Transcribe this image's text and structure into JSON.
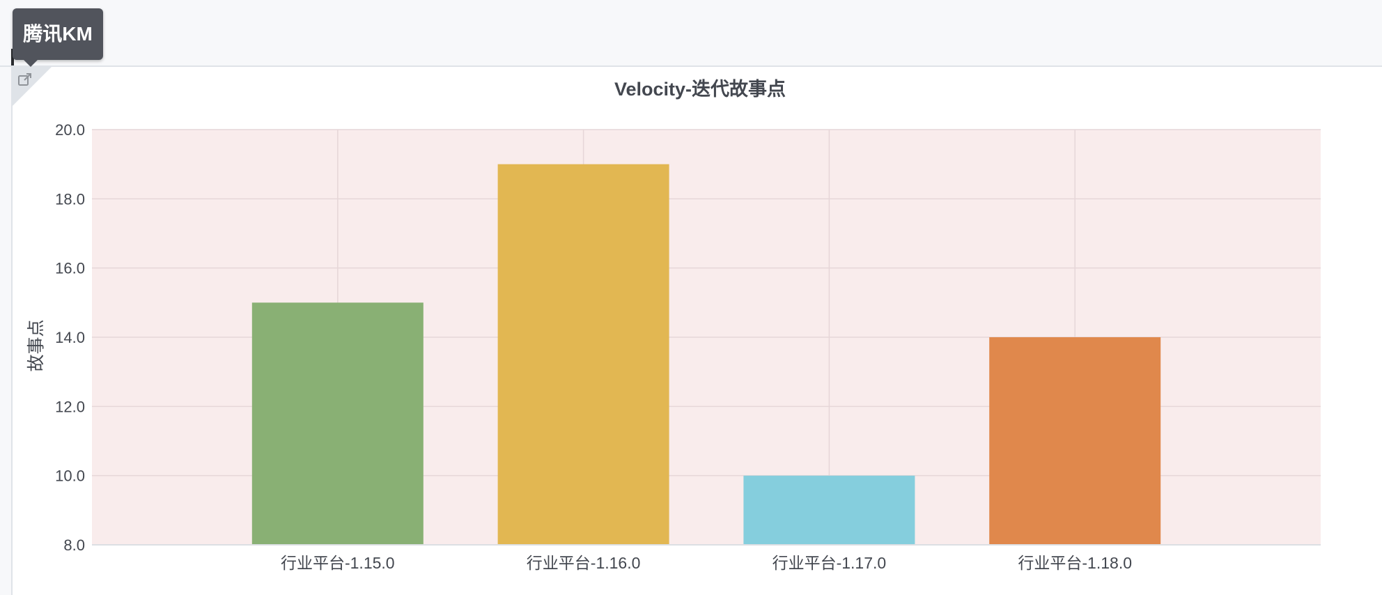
{
  "tooltip": {
    "text": "腾讯KM"
  },
  "icons": {
    "open_link": "external-link-icon"
  },
  "colors": {
    "plot_background": "#f9ecec",
    "grid": "#e6d6d8",
    "text": "#43474f"
  },
  "chart_data": {
    "type": "bar",
    "title": "Velocity-迭代故事点",
    "xlabel": "",
    "ylabel": "故事点",
    "categories": [
      "行业平台-1.15.0",
      "行业平台-1.16.0",
      "行业平台-1.17.0",
      "行业平台-1.18.0"
    ],
    "values": [
      15,
      19,
      10,
      14
    ],
    "colors": [
      "#89b074",
      "#e2b752",
      "#85cedd",
      "#e0884c"
    ],
    "ylim": [
      8,
      20
    ],
    "yticks": [
      "8.0",
      "10.0",
      "12.0",
      "14.0",
      "16.0",
      "18.0",
      "20.0"
    ],
    "grid": true,
    "legend": "none"
  }
}
